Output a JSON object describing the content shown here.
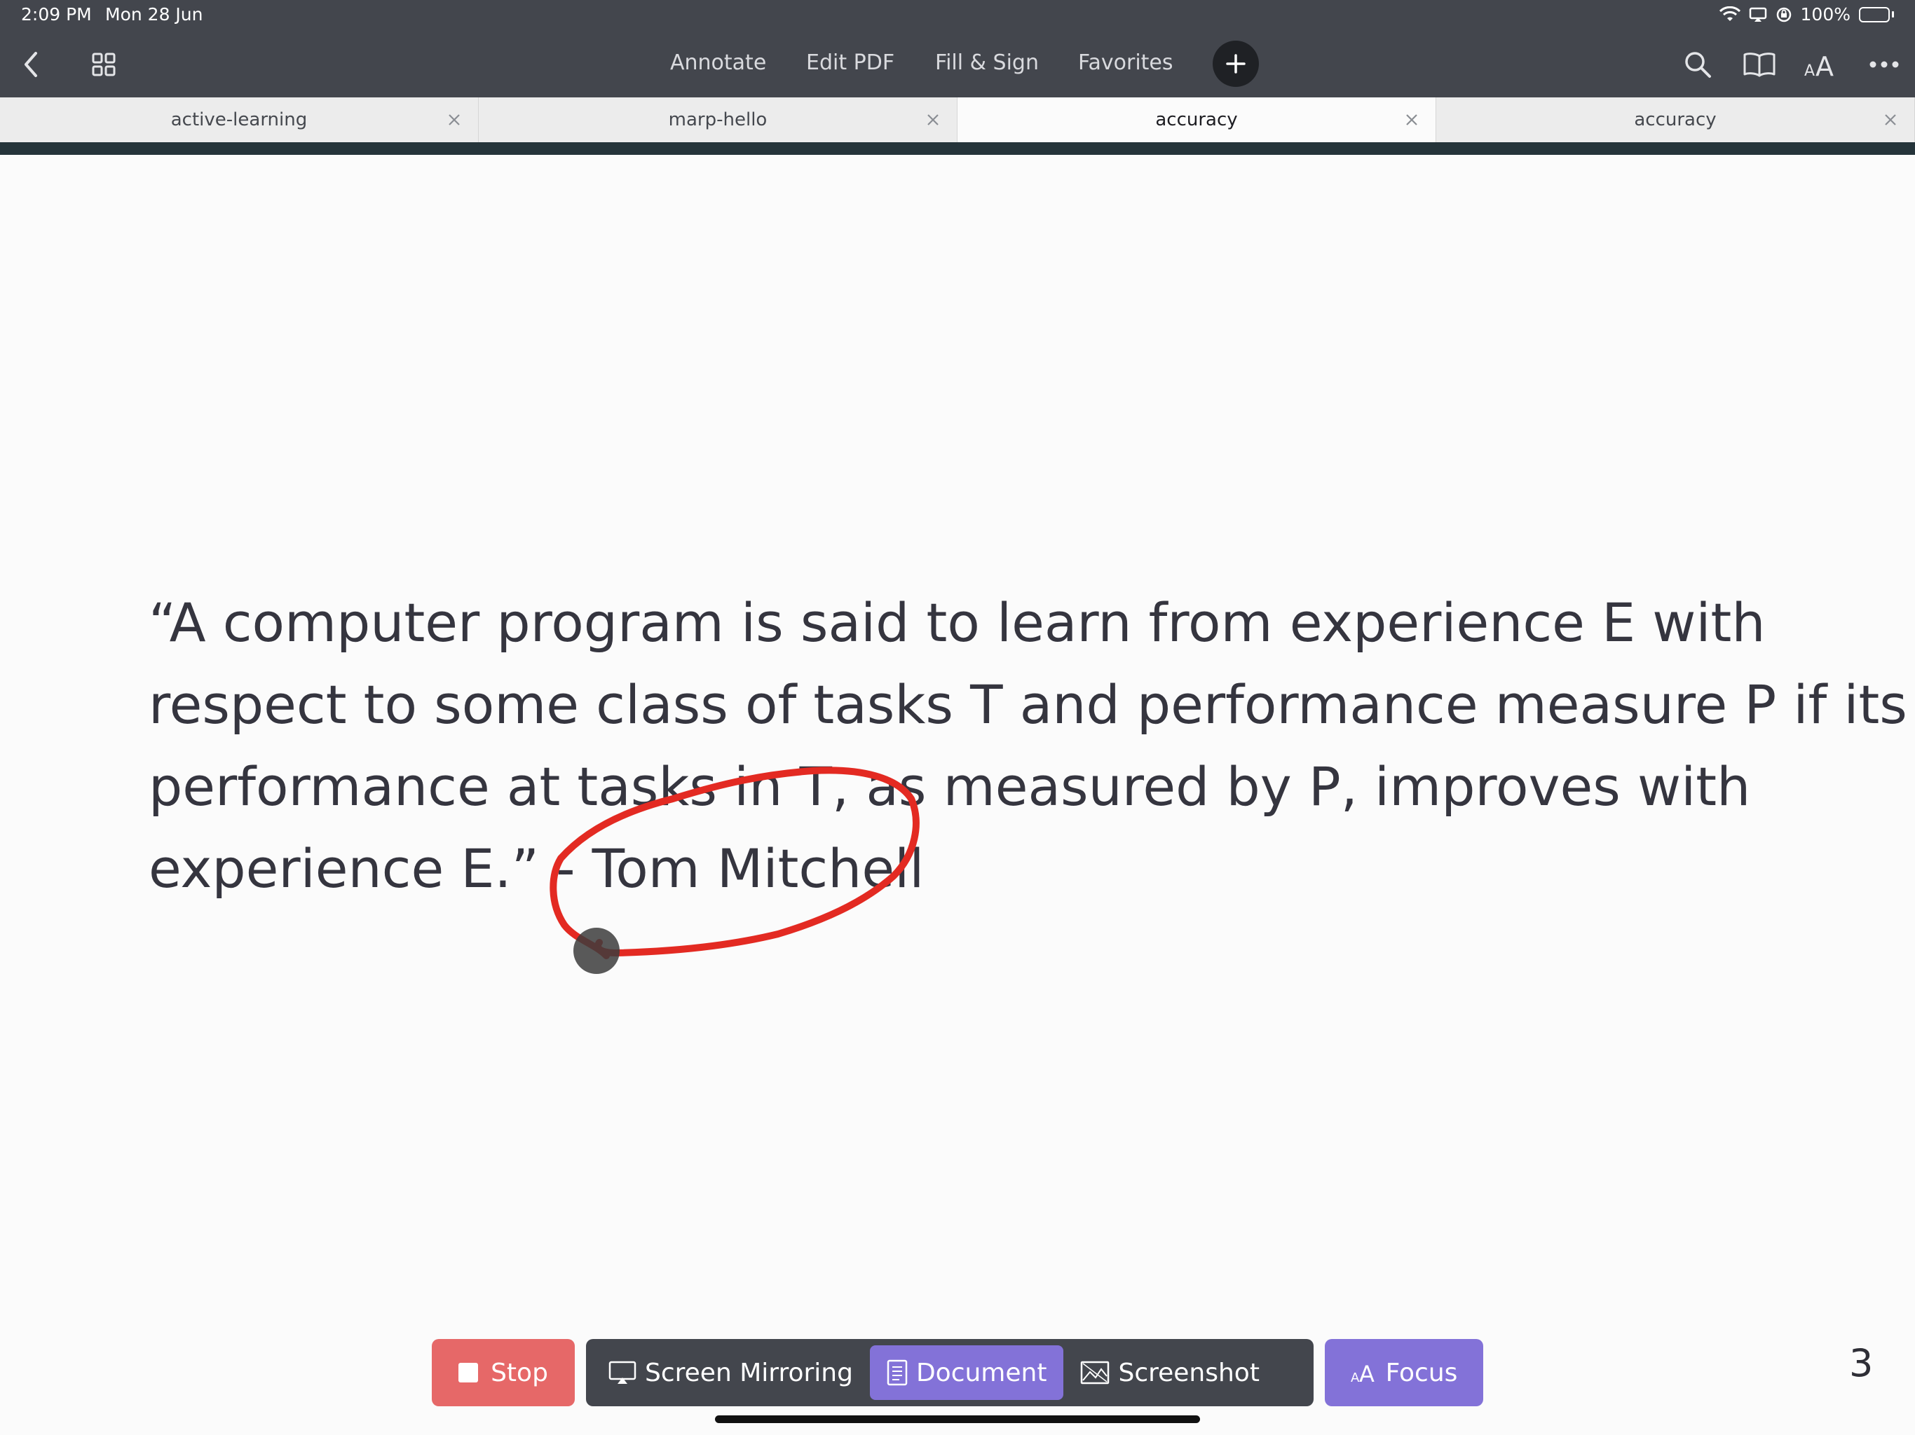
{
  "status_bar": {
    "time": "2:09 PM",
    "date": "Mon 28 Jun",
    "battery": "100%",
    "icons": [
      "wifi-icon",
      "screen-mirror-icon",
      "orientation-lock-icon",
      "battery-charging-icon"
    ]
  },
  "toolbar": {
    "menu": [
      "Annotate",
      "Edit PDF",
      "Fill & Sign",
      "Favorites"
    ],
    "left_icons": [
      "back-chevron-icon",
      "grid-icon"
    ],
    "right_icons": [
      "search-icon",
      "book-icon",
      "text-size-icon",
      "more-icon"
    ]
  },
  "tabs": [
    {
      "label": "active-learning",
      "active": false
    },
    {
      "label": "marp-hello",
      "active": false
    },
    {
      "label": "accuracy",
      "active": true
    },
    {
      "label": "accuracy",
      "active": false
    }
  ],
  "document": {
    "quote_lines": [
      "“A computer program is said to learn from experience E with",
      "respect to some class of tasks T and performance measure P if its",
      "performance at tasks in T, as measured by P, improves with",
      "experience E.” - Tom Mitchell"
    ],
    "annotation_color": "#e32a22"
  },
  "bottom_controls": {
    "stop": "Stop",
    "screen_mirroring": "Screen Mirroring",
    "document": "Document",
    "screenshot": "Screenshot",
    "focus": "Focus",
    "selected": "Document"
  },
  "page_number": "3",
  "colors": {
    "toolbar_bg": "#43464d",
    "accent_purple": "#8372d8",
    "stop_red": "#e66868"
  }
}
